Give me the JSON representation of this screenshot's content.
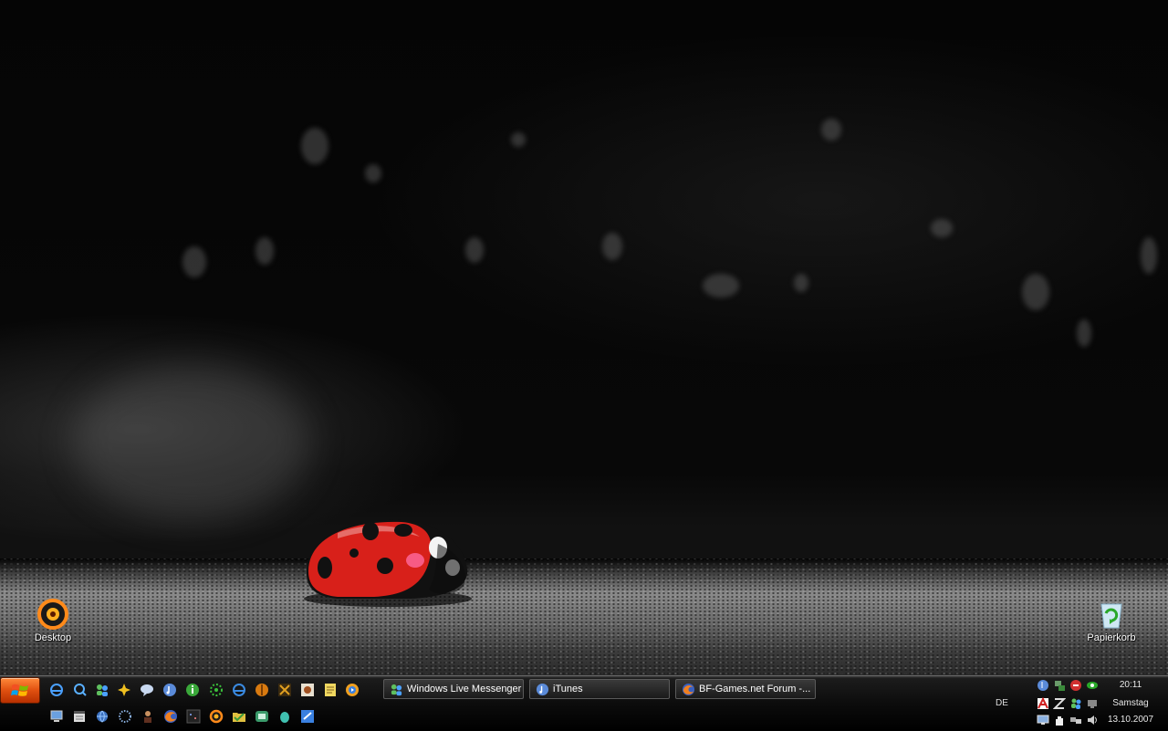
{
  "desktop": {
    "icons": [
      {
        "label": "Desktop",
        "icon": "orange-ring-icon"
      },
      {
        "label": "Papierkorb",
        "icon": "recycle-bin-icon"
      }
    ]
  },
  "taskbar": {
    "start_icon": "windows-flag-icon",
    "quick_launch": [
      "internet-explorer-icon",
      "search-icon",
      "messenger-icon",
      "cross-app-icon",
      "chat-bubble-icon",
      "itunes-icon",
      "info-icon",
      "green-star-icon",
      "internet-explorer-icon",
      "orange-ball-icon",
      "game-icon",
      "media-icon",
      "notepad-icon",
      "media-player-icon",
      "computer-icon",
      "calendar-icon",
      "globe-icon",
      "dotted-circle-icon",
      "person-icon",
      "firefox-icon",
      "dark-app-icon",
      "orange-ring-icon",
      "folder-icon",
      "green-app-icon",
      "egg-icon",
      "blue-app-icon"
    ],
    "tasks": [
      {
        "label": "Windows Live Messenger",
        "icon": "messenger-icon"
      },
      {
        "label": "iTunes",
        "icon": "itunes-icon"
      },
      {
        "label": "BF-Games.net Forum -...",
        "icon": "firefox-icon"
      }
    ],
    "language": "DE",
    "clock": {
      "time": "20:11",
      "day": "Samstag",
      "date": "13.10.2007"
    },
    "tray_icons": [
      "itunes-icon",
      "network-icon",
      "stop-icon",
      "eye-icon",
      "antivirus-icon",
      "zonealarm-icon",
      "messenger-icon",
      "display-icon",
      "monitor-icon",
      "hand-icon",
      "network-icon",
      "volume-icon"
    ]
  },
  "colors": {
    "start_button": "#e05010",
    "ladybug": "#d8201a"
  }
}
